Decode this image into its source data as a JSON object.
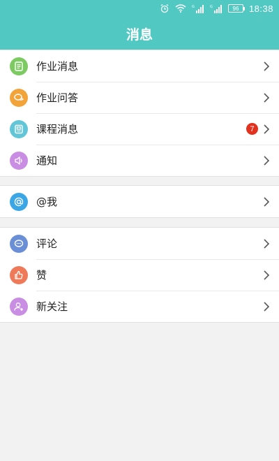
{
  "status_bar": {
    "battery": "96",
    "time": "18:38"
  },
  "header": {
    "title": "消息"
  },
  "groups": [
    {
      "items": [
        {
          "label": "作业消息",
          "icon": "homework-list-icon",
          "color": "#7dca63"
        },
        {
          "label": "作业问答",
          "icon": "qa-chat-icon",
          "color": "#f2a33a"
        },
        {
          "label": "课程消息",
          "icon": "course-icon",
          "color": "#62c6d8",
          "badge": "7"
        },
        {
          "label": "通知",
          "icon": "speaker-icon",
          "color": "#c98de4"
        }
      ]
    },
    {
      "items": [
        {
          "label": "@我",
          "icon": "at-icon",
          "color": "#3ba6e6"
        }
      ]
    },
    {
      "items": [
        {
          "label": "评论",
          "icon": "comment-icon",
          "color": "#6a8fd6"
        },
        {
          "label": "赞",
          "icon": "thumbs-up-icon",
          "color": "#ef7a5a"
        },
        {
          "label": "新关注",
          "icon": "follow-user-icon",
          "color": "#c98de4"
        }
      ]
    }
  ],
  "colors": {
    "header": "#52c8c3",
    "badge": "#e0321e",
    "background": "#f2f2f2"
  }
}
